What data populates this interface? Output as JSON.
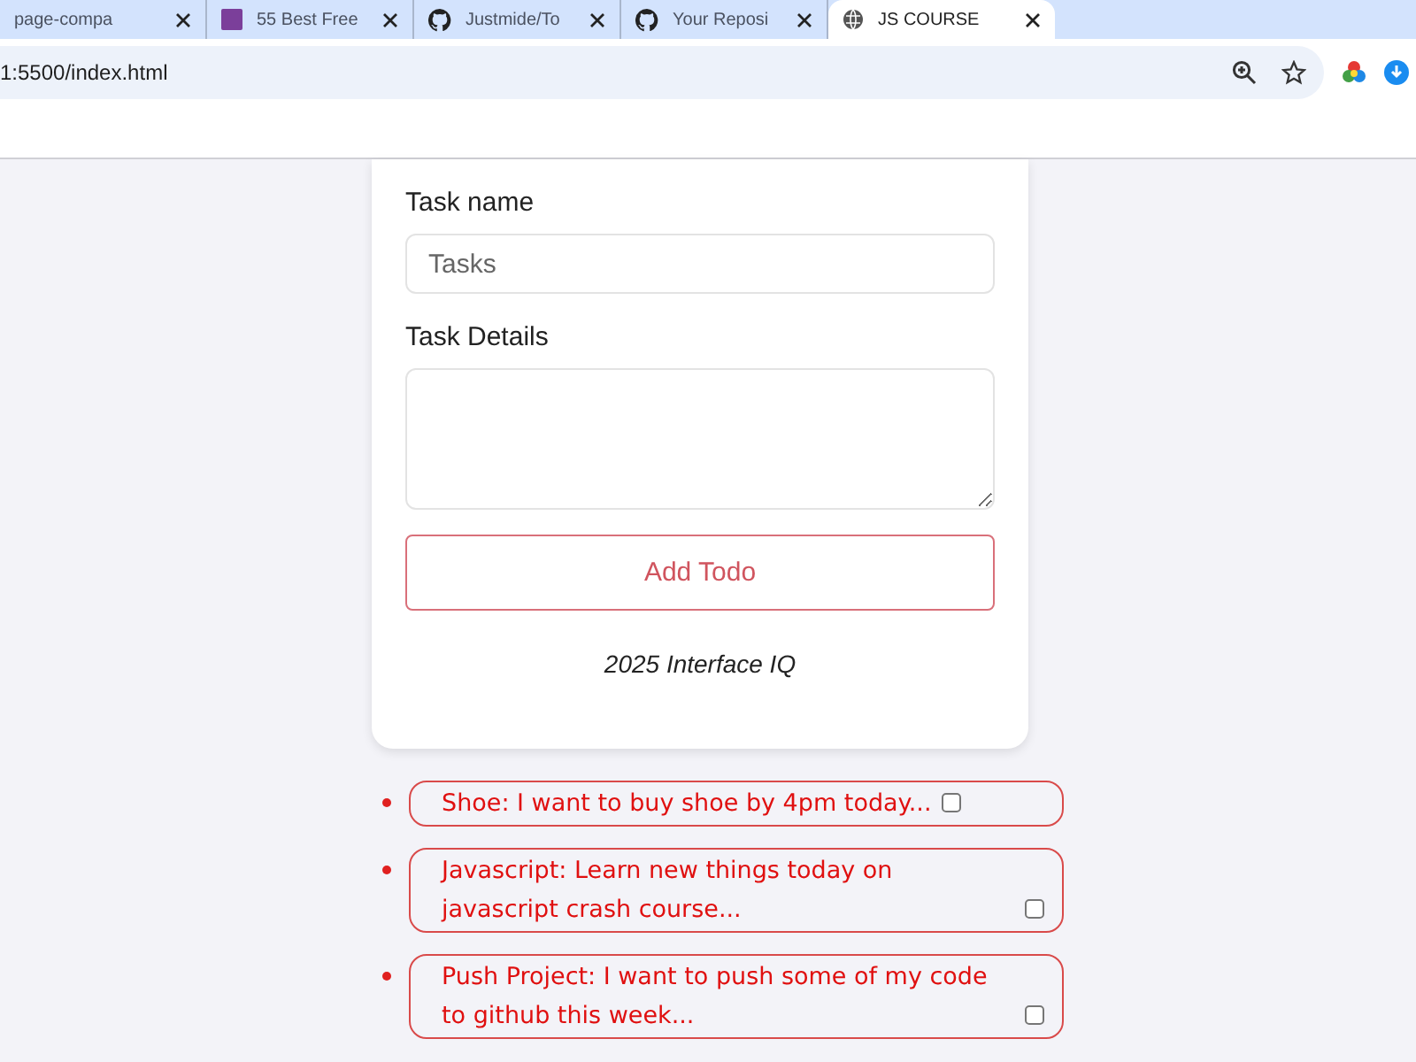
{
  "browser": {
    "tabs": [
      {
        "title": "page-compa",
        "selected": false
      },
      {
        "title": "55 Best Free",
        "selected": false
      },
      {
        "title": "Justmide/To",
        "selected": false
      },
      {
        "title": "Your Reposi",
        "selected": false
      },
      {
        "title": "JS COURSE",
        "selected": true
      }
    ],
    "address": "1:5500/index.html"
  },
  "form": {
    "fields": [
      {
        "label": "Task name",
        "kind": "input",
        "placeholder": "Tasks"
      },
      {
        "label": "Task Details",
        "kind": "textarea"
      }
    ],
    "button": "Add Todo",
    "footer": "2025 Interface IQ"
  },
  "todos": [
    {
      "text": "Shoe: I want to buy shoe by 4pm today...",
      "checked": false
    },
    {
      "text": "Javascript: Learn new things today on javascript crash course...",
      "checked": false
    },
    {
      "text": "Push Project: I want to push some of my code to github this week...",
      "checked": false
    }
  ]
}
